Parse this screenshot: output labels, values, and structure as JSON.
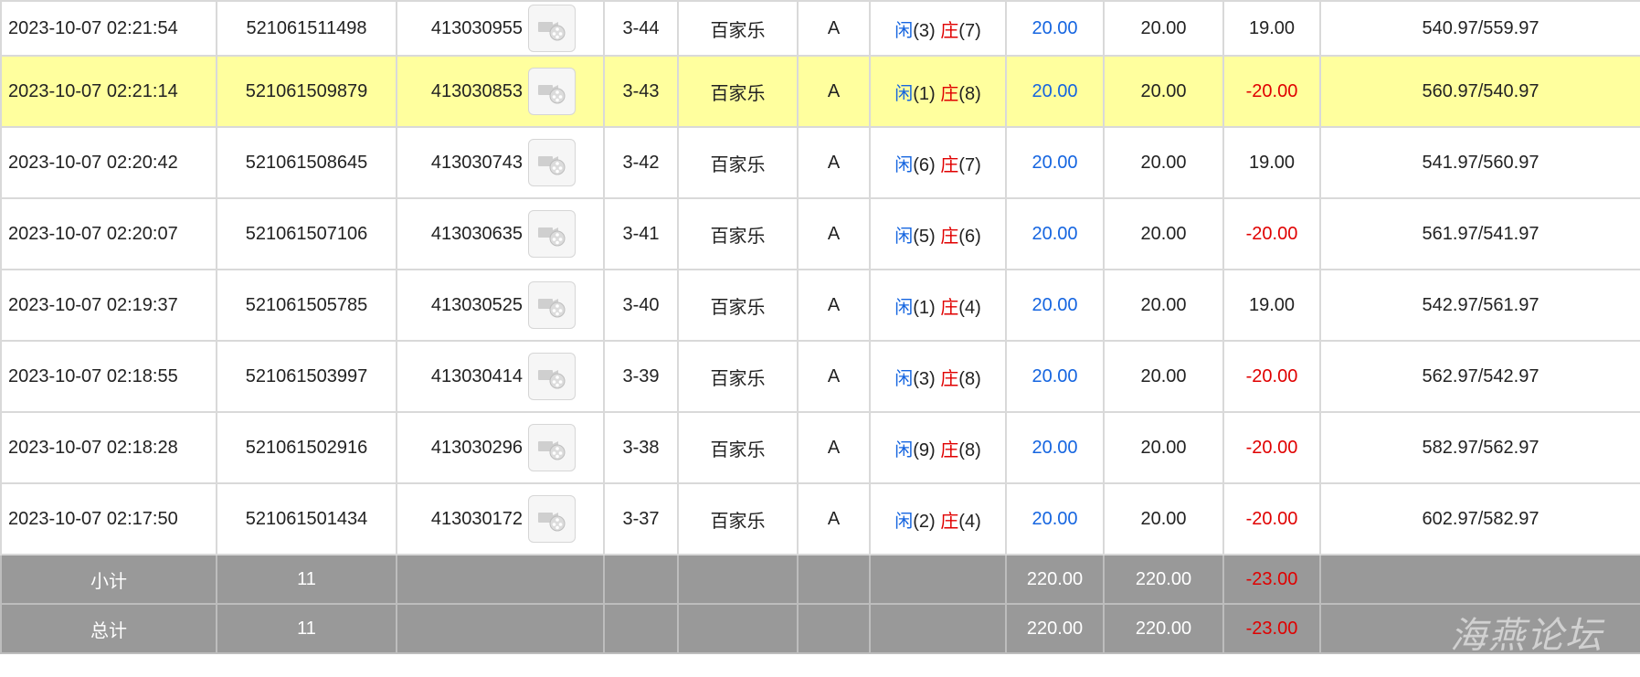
{
  "rows": [
    {
      "time": "2023-10-07 02:21:54",
      "bet_id": "521061511498",
      "round_id": "413030955",
      "shoe": "3-44",
      "game": "百家乐",
      "table": "A",
      "player_label": "闲",
      "player_pts": "(3)",
      "banker_label": "庄",
      "banker_pts": "(7)",
      "bet": "20.00",
      "valid_bet": "20.00",
      "win_loss": "19.00",
      "balance": "540.97/559.97"
    },
    {
      "time": "2023-10-07 02:21:14",
      "bet_id": "521061509879",
      "round_id": "413030853",
      "shoe": "3-43",
      "game": "百家乐",
      "table": "A",
      "player_label": "闲",
      "player_pts": "(1)",
      "banker_label": "庄",
      "banker_pts": "(8)",
      "bet": "20.00",
      "valid_bet": "20.00",
      "win_loss": "-20.00",
      "balance": "560.97/540.97"
    },
    {
      "time": "2023-10-07 02:20:42",
      "bet_id": "521061508645",
      "round_id": "413030743",
      "shoe": "3-42",
      "game": "百家乐",
      "table": "A",
      "player_label": "闲",
      "player_pts": "(6)",
      "banker_label": "庄",
      "banker_pts": "(7)",
      "bet": "20.00",
      "valid_bet": "20.00",
      "win_loss": "19.00",
      "balance": "541.97/560.97"
    },
    {
      "time": "2023-10-07 02:20:07",
      "bet_id": "521061507106",
      "round_id": "413030635",
      "shoe": "3-41",
      "game": "百家乐",
      "table": "A",
      "player_label": "闲",
      "player_pts": "(5)",
      "banker_label": "庄",
      "banker_pts": "(6)",
      "bet": "20.00",
      "valid_bet": "20.00",
      "win_loss": "-20.00",
      "balance": "561.97/541.97"
    },
    {
      "time": "2023-10-07 02:19:37",
      "bet_id": "521061505785",
      "round_id": "413030525",
      "shoe": "3-40",
      "game": "百家乐",
      "table": "A",
      "player_label": "闲",
      "player_pts": "(1)",
      "banker_label": "庄",
      "banker_pts": "(4)",
      "bet": "20.00",
      "valid_bet": "20.00",
      "win_loss": "19.00",
      "balance": "542.97/561.97"
    },
    {
      "time": "2023-10-07 02:18:55",
      "bet_id": "521061503997",
      "round_id": "413030414",
      "shoe": "3-39",
      "game": "百家乐",
      "table": "A",
      "player_label": "闲",
      "player_pts": "(3)",
      "banker_label": "庄",
      "banker_pts": "(8)",
      "bet": "20.00",
      "valid_bet": "20.00",
      "win_loss": "-20.00",
      "balance": "562.97/542.97"
    },
    {
      "time": "2023-10-07 02:18:28",
      "bet_id": "521061502916",
      "round_id": "413030296",
      "shoe": "3-38",
      "game": "百家乐",
      "table": "A",
      "player_label": "闲",
      "player_pts": "(9)",
      "banker_label": "庄",
      "banker_pts": "(8)",
      "bet": "20.00",
      "valid_bet": "20.00",
      "win_loss": "-20.00",
      "balance": "582.97/562.97"
    },
    {
      "time": "2023-10-07 02:17:50",
      "bet_id": "521061501434",
      "round_id": "413030172",
      "shoe": "3-37",
      "game": "百家乐",
      "table": "A",
      "player_label": "闲",
      "player_pts": "(2)",
      "banker_label": "庄",
      "banker_pts": "(4)",
      "bet": "20.00",
      "valid_bet": "20.00",
      "win_loss": "-20.00",
      "balance": "602.97/582.97"
    }
  ],
  "subtotal": {
    "label": "小计",
    "count": "11",
    "bet": "220.00",
    "valid_bet": "220.00",
    "win_loss": "-23.00"
  },
  "total": {
    "label": "总计",
    "count": "11",
    "bet": "220.00",
    "valid_bet": "220.00",
    "win_loss": "-23.00"
  },
  "watermark": "海燕论坛",
  "colors": {
    "highlight_row": "#ffff9e",
    "player_blue": "#1565e0",
    "banker_red": "#e00000",
    "summary_bg": "#999999"
  },
  "icons": {
    "round_video": "video-reel-icon"
  }
}
